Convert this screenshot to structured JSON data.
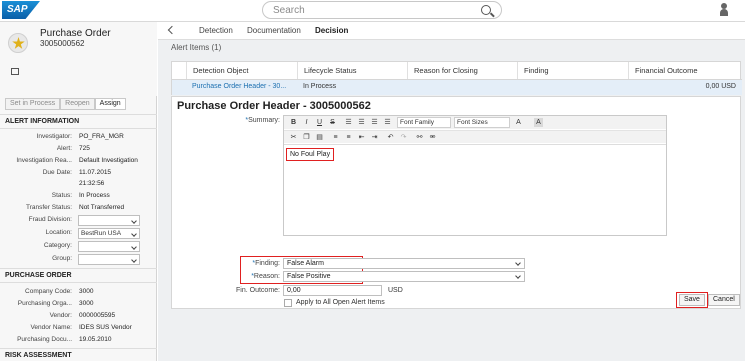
{
  "header": {
    "logo": "SAP",
    "search_placeholder": "Search",
    "user_icon": "user-icon"
  },
  "object": {
    "title": "Purchase Order",
    "number": "3005000562"
  },
  "actions": {
    "set_in_process": "Set in Process",
    "reopen": "Reopen",
    "assign": "Assign"
  },
  "alert_info": {
    "title": "ALERT INFORMATION",
    "fields": [
      {
        "label": "Investigator:",
        "value": "PO_FRA_MGR"
      },
      {
        "label": "Alert:",
        "value": "725"
      },
      {
        "label": "Investigation Rea...",
        "value": "Default Investigation"
      },
      {
        "label": "Due Date:",
        "value": "11.07.2015"
      },
      {
        "label": "",
        "value": "21:32:56"
      },
      {
        "label": "Status:",
        "value": "In Process"
      },
      {
        "label": "Transfer Status:",
        "value": "Not Transferred"
      }
    ],
    "selects": [
      {
        "label": "Fraud Division:",
        "value": ""
      },
      {
        "label": "Location:",
        "value": "BestRun USA"
      },
      {
        "label": "Category:",
        "value": ""
      },
      {
        "label": "Group:",
        "value": ""
      }
    ]
  },
  "purchase_order": {
    "title": "PURCHASE ORDER",
    "fields": [
      {
        "label": "Company Code:",
        "value": "3000"
      },
      {
        "label": "Purchasing Orga...",
        "value": "3000"
      },
      {
        "label": "Vendor:",
        "value": "0000005595"
      },
      {
        "label": "Vendor Name:",
        "value": "IDES SUS Vendor"
      },
      {
        "label": "Purchasing Docu...",
        "value": "19.05.2010"
      }
    ]
  },
  "risk_title": "RISK ASSESSMENT",
  "tabs": [
    "Detection",
    "Documentation",
    "Decision"
  ],
  "alert_items": {
    "caption": "Alert Items (1)",
    "columns": [
      "Detection Object",
      "Lifecycle Status",
      "Reason for Closing",
      "Finding",
      "Financial Outcome"
    ],
    "row": {
      "detection_object": "Purchase Order Header - 30...",
      "lifecycle_status": "In Process",
      "reason": "",
      "finding": "",
      "financial_outcome": "0,00 USD"
    }
  },
  "decision": {
    "title": "Purchase Order Header - 3005000562",
    "summary_label": "Summary:",
    "font_family": "Font Family",
    "font_sizes": "Font Sizes",
    "summary_text": "No Foul Play",
    "finding_label": "Finding:",
    "finding_value": "False Alarm",
    "reason_label": "Reason:",
    "reason_value": "False Positive",
    "outcome_label": "Fin. Outcome:",
    "outcome_value": "0,00",
    "currency": "USD",
    "apply_all": "Apply to All Open Alert Items",
    "save": "Save",
    "cancel": "Cancel"
  }
}
